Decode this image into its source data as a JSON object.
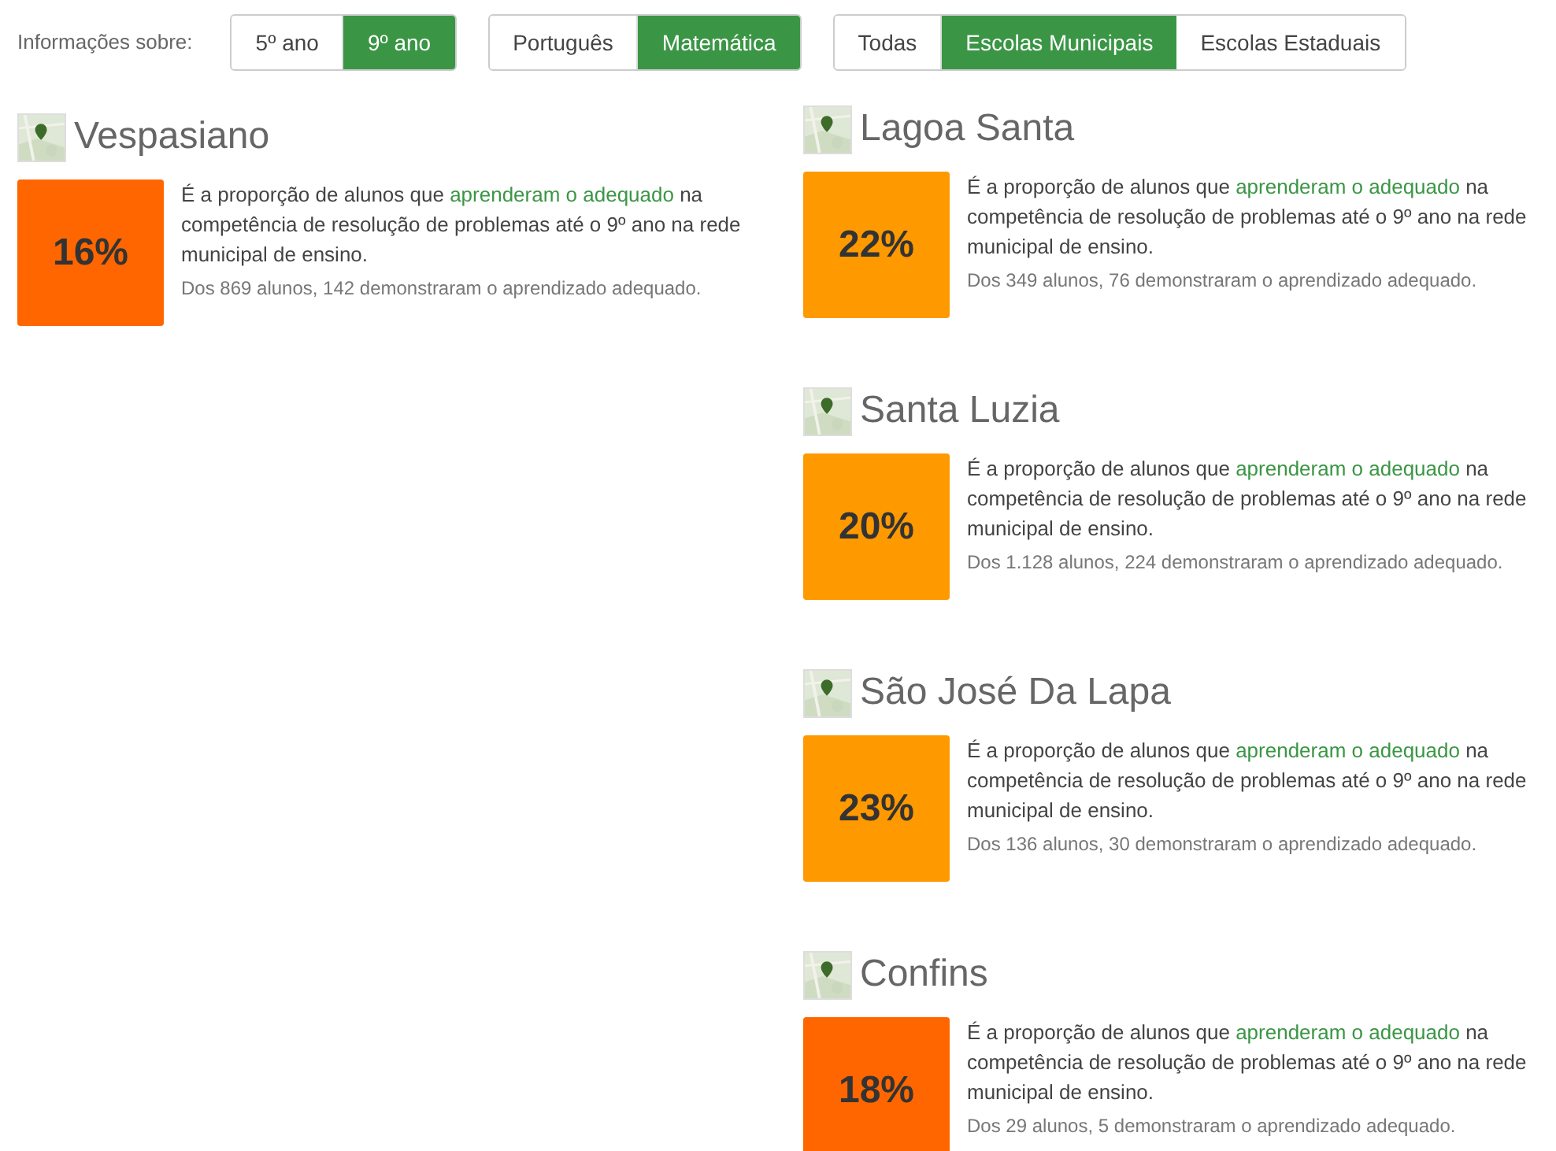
{
  "filter_label": "Informações sobre:",
  "filter_groups": [
    {
      "options": [
        {
          "label": "5º ano",
          "selected": false
        },
        {
          "label": "9º ano",
          "selected": true
        }
      ]
    },
    {
      "options": [
        {
          "label": "Português",
          "selected": false
        },
        {
          "label": "Matemática",
          "selected": true
        }
      ]
    },
    {
      "options": [
        {
          "label": "Todas",
          "selected": false
        },
        {
          "label": "Escolas Municipais",
          "selected": true
        },
        {
          "label": "Escolas Estaduais",
          "selected": false
        }
      ]
    }
  ],
  "columns": [
    {
      "cities": [
        {
          "name": "Vespasiano",
          "percent": "16%",
          "color": "#ff6600",
          "text_before": "É a proporção de alunos que",
          "link": "aprenderam o adequado",
          "text_after": "na competência de resolução de problemas até o 9º ano na rede municipal de ensino.",
          "detail": "Dos 869 alunos, 142 demonstraram o aprendizado adequado."
        }
      ]
    },
    {
      "cities": [
        {
          "name": "Lagoa Santa",
          "percent": "22%",
          "color": "#ff9900",
          "text_before": "É a proporção de alunos que",
          "link": "aprenderam o adequado",
          "text_after": "na competência de resolução de problemas até o 9º ano na rede municipal de ensino.",
          "detail": "Dos 349 alunos, 76 demonstraram o aprendizado adequado."
        },
        {
          "name": "Santa Luzia",
          "percent": "20%",
          "color": "#ff9900",
          "text_before": "É a proporção de alunos que",
          "link": "aprenderam o adequado",
          "text_after": "na competência de resolução de problemas até o 9º ano na rede municipal de ensino.",
          "detail": "Dos 1.128 alunos, 224 demonstraram o aprendizado adequado."
        },
        {
          "name": "São José Da Lapa",
          "percent": "23%",
          "color": "#ff9900",
          "text_before": "É a proporção de alunos que",
          "link": "aprenderam o adequado",
          "text_after": "na competência de resolução de problemas até o 9º ano na rede municipal de ensino.",
          "detail": "Dos 136 alunos, 30 demonstraram o aprendizado adequado."
        },
        {
          "name": "Confins",
          "percent": "18%",
          "color": "#ff6600",
          "text_before": "É a proporção de alunos que",
          "link": "aprenderam o adequado",
          "text_after": "na competência de resolução de problemas até o 9º ano na rede municipal de ensino.",
          "detail": "Dos 29 alunos, 5 demonstraram o aprendizado adequado."
        }
      ]
    }
  ]
}
